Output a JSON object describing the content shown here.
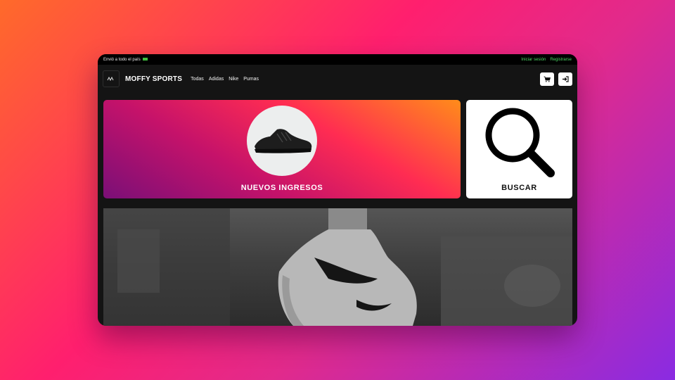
{
  "topbar": {
    "shipping_text": "Envió a todo el país",
    "login_link": "Iniciar sesión",
    "register_link": "Registrarse"
  },
  "navbar": {
    "brand": "MOFFY SPORTS",
    "links": [
      "Todas",
      "Adidas",
      "Nike",
      "Pumas"
    ]
  },
  "cards": {
    "new_arrivals_label": "NUEVOS INGRESOS",
    "search_label": "BUSCAR"
  },
  "colors": {
    "accent_link": "#4cd964",
    "window_bg": "#141414"
  }
}
